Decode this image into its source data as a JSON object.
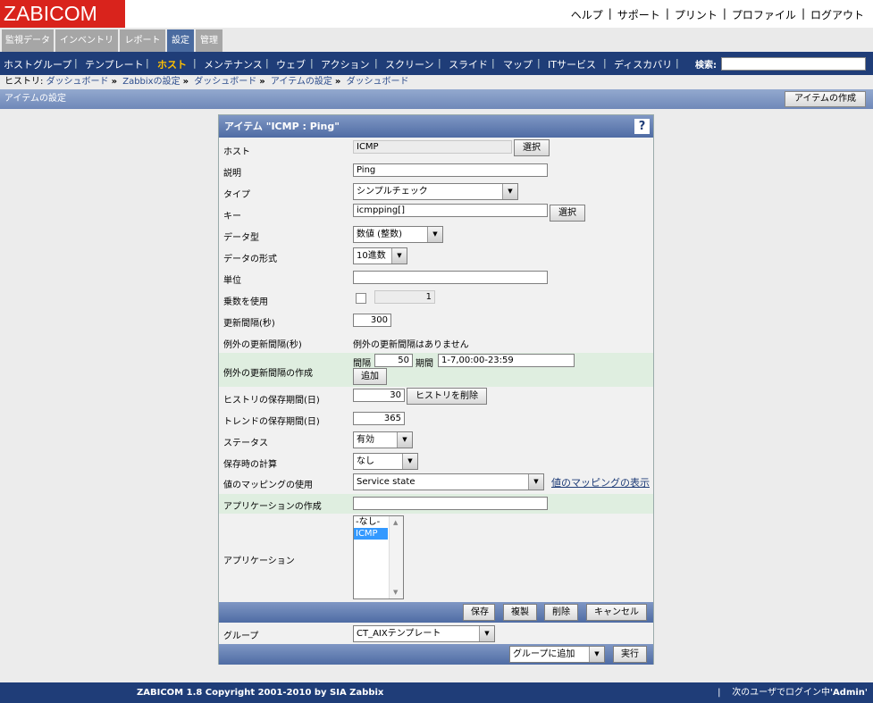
{
  "brand": {
    "logo": "ZABICOM",
    "accent": "#d9231c",
    "nav_color": "#1f3d78",
    "link_color": "#1f3d78"
  },
  "toplinks": [
    "ヘルプ",
    "サポート",
    "プリント",
    "プロファイル",
    "ログアウト"
  ],
  "main_tabs": [
    {
      "label": "監視データ",
      "active": false
    },
    {
      "label": "インベントリ",
      "active": false
    },
    {
      "label": "レポート",
      "active": false
    },
    {
      "label": "設定",
      "active": true
    },
    {
      "label": "管理",
      "active": false
    }
  ],
  "submenu": {
    "items": [
      "ホストグループ",
      "テンプレート",
      "ホスト",
      "メンテナンス",
      "ウェブ",
      "アクション",
      "スクリーン",
      "スライド",
      "マップ",
      "ITサービス",
      "ディスカバリ"
    ],
    "active": "ホスト",
    "search_label": "検索:"
  },
  "breadcrumb": {
    "label": "ヒストリ:",
    "items": [
      "ダッシュボード",
      "Zabbixの設定",
      "ダッシュボード",
      "アイテムの設定",
      "ダッシュボード"
    ]
  },
  "titlebar": {
    "title": "アイテムの設定",
    "create_button": "アイテムの作成"
  },
  "form": {
    "header": "アイテム \"ICMP : Ping\"",
    "help_icon": "?",
    "labels": {
      "host": "ホスト",
      "description": "説明",
      "type": "タイプ",
      "key": "キー",
      "value_type": "データ型",
      "data_type": "データの形式",
      "units": "単位",
      "multiplier": "乗数を使用",
      "delay": "更新間隔(秒)",
      "flex_intervals": "例外の更新間隔(秒)",
      "new_flex": "例外の更新間隔の作成",
      "history": "ヒストリの保存期間(日)",
      "trends": "トレンドの保存期間(日)",
      "status": "ステータス",
      "delta": "保存時の計算",
      "valuemap": "値のマッピングの使用",
      "new_application": "アプリケーションの作成",
      "applications": "アプリケーション",
      "group": "グループ"
    },
    "values": {
      "host": "ICMP",
      "description": "Ping",
      "type": "シンプルチェック",
      "key": "icmpping[]",
      "value_type": "数値 (整数)",
      "data_type": "10進数",
      "units": "",
      "multiplier_checked": false,
      "multiplier": "1",
      "delay": "300",
      "flex_none": "例外の更新間隔はありません",
      "flex_interval_label": "間隔",
      "flex_interval": "50",
      "flex_period_label": "期間",
      "flex_period": "1-7,00:00-23:59",
      "history": "30",
      "trends": "365",
      "status": "有効",
      "delta": "なし",
      "valuemap": "Service state",
      "new_application": "",
      "applications": [
        "-なし-",
        "ICMP"
      ],
      "applications_selected": "ICMP",
      "group": "CT_AIXテンプレート",
      "group_action": "グループに追加"
    },
    "buttons": {
      "select": "選択",
      "add": "追加",
      "clear_history": "ヒストリを削除",
      "valuemap_link": "値のマッピングの表示",
      "save": "保存",
      "clone": "複製",
      "delete": "削除",
      "cancel": "キャンセル",
      "execute": "実行"
    }
  },
  "footer": {
    "copyright": "ZABICOM 1.8 Copyright 2001-2010 by SIA Zabbix",
    "login_prefix": "次のユーザでログイン中",
    "user": "'Admin'"
  }
}
